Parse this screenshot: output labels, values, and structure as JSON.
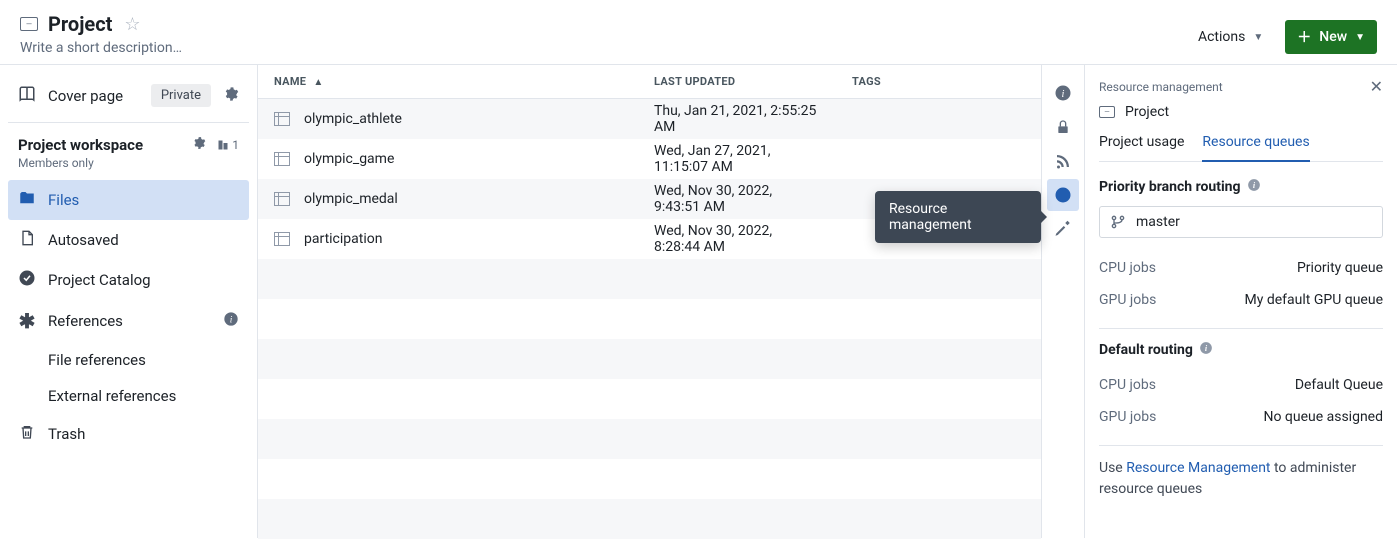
{
  "header": {
    "title": "Project",
    "descriptionPlaceholder": "Write a short description…",
    "actionsLabel": "Actions",
    "newLabel": "New"
  },
  "sidebarLeft": {
    "coverPage": "Cover page",
    "privacyBadge": "Private",
    "workspaceTitle": "Project workspace",
    "memberCount": "1",
    "membersOnly": "Members only",
    "nav": {
      "files": "Files",
      "autosaved": "Autosaved",
      "projectCatalog": "Project Catalog",
      "references": "References",
      "fileReferences": "File references",
      "externalReferences": "External references",
      "trash": "Trash"
    }
  },
  "table": {
    "columns": {
      "name": "NAME",
      "lastUpdated": "LAST UPDATED",
      "tags": "TAGS"
    },
    "rows": [
      {
        "name": "olympic_athlete",
        "updated": "Thu, Jan 21, 2021, 2:55:25 AM"
      },
      {
        "name": "olympic_game",
        "updated": "Wed, Jan 27, 2021, 11:15:07 AM"
      },
      {
        "name": "olympic_medal",
        "updated": "Wed, Nov 30, 2022, 9:43:51 AM"
      },
      {
        "name": "participation",
        "updated": "Wed, Nov 30, 2022, 8:28:44 AM"
      }
    ]
  },
  "tooltip": "Resource management",
  "panel": {
    "headerText": "Resource management",
    "projectName": "Project",
    "tabs": {
      "usage": "Project usage",
      "queues": "Resource queues"
    },
    "priorityRouting": {
      "title": "Priority branch routing",
      "branch": "master",
      "cpuLabel": "CPU jobs",
      "gpuLabel": "GPU jobs",
      "cpuValue": "Priority queue",
      "gpuValue": "My default GPU queue"
    },
    "defaultRouting": {
      "title": "Default routing",
      "cpuLabel": "CPU jobs",
      "gpuLabel": "GPU jobs",
      "cpuValue": "Default Queue",
      "gpuValue": "No queue assigned"
    },
    "footer": {
      "prefix": "Use ",
      "link": "Resource Management",
      "suffix": " to administer resource queues"
    }
  }
}
